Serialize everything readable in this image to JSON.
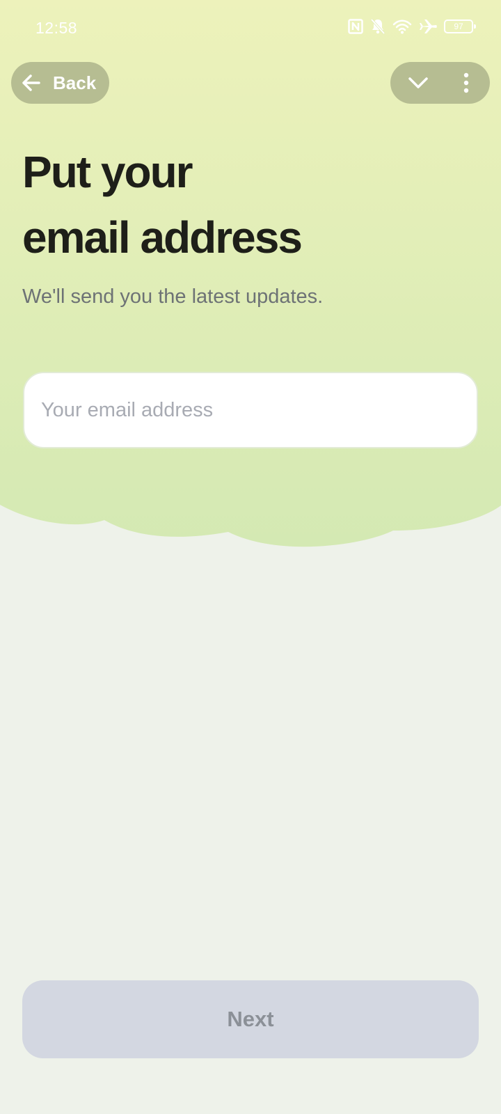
{
  "status_bar": {
    "time": "12:58",
    "icons": [
      "nfc-icon",
      "notifications-off-icon",
      "wifi-icon",
      "airplane-mode-icon",
      "battery-icon"
    ],
    "battery_level": "97"
  },
  "nav": {
    "back_label": "Back",
    "back_icon": "arrow-left-icon",
    "collapse_icon": "chevron-down-icon",
    "menu_icon": "more-vertical-icon"
  },
  "header": {
    "title_line1": "Put your",
    "title_line2": "email address",
    "subtitle": "We'll send you the latest updates."
  },
  "form": {
    "email_placeholder": "Your email address",
    "email_value": ""
  },
  "footer": {
    "next_label": "Next"
  },
  "colors": {
    "hero_top": "#edf2bb",
    "hero_bottom": "#d4e9b3",
    "page_background": "#eef2ea",
    "pill_background": "#b6bd92",
    "next_button_background": "#d3d7e1",
    "next_button_text": "#8b9097"
  }
}
